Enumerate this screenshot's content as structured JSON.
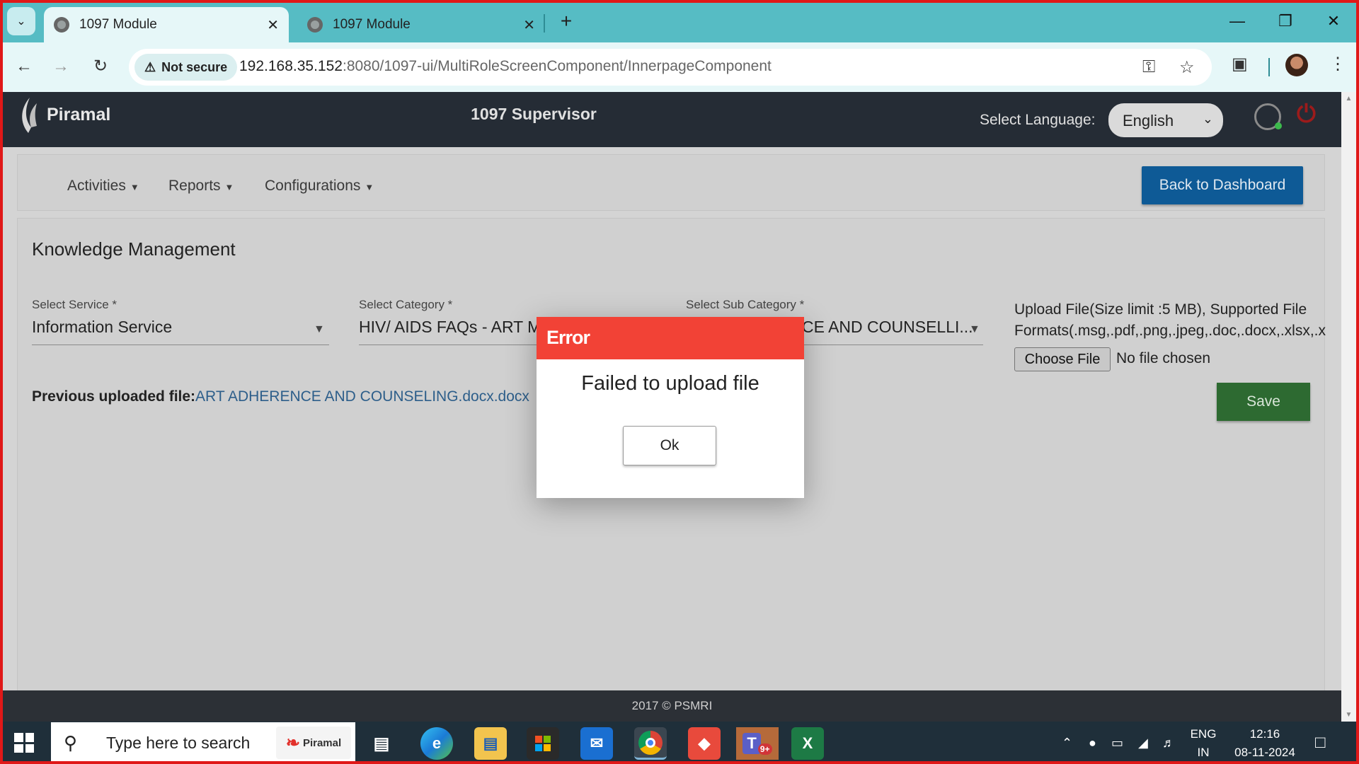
{
  "browser": {
    "tabs": [
      {
        "title": "1097 Module",
        "active": true
      },
      {
        "title": "1097 Module",
        "active": false
      }
    ],
    "security_label": "Not secure",
    "url_host": "192.168.35.152",
    "url_rest": ":8080/1097-ui/MultiRoleScreenComponent/InnerpageComponent"
  },
  "app": {
    "brand": "Piramal",
    "title": "1097 Supervisor",
    "language_label": "Select Language:",
    "language_value": "English"
  },
  "menu": {
    "items": [
      "Activities",
      "Reports",
      "Configurations"
    ],
    "back_button": "Back to Dashboard"
  },
  "form": {
    "title": "Knowledge Management",
    "service_label": "Select Service *",
    "service_value": "Information Service",
    "category_label": "Select Category *",
    "category_value": "HIV/ AIDS FAQs - ART Mar",
    "subcategory_label": "Select Sub Category *",
    "subcategory_value": "CE AND COUNSELLI...",
    "upload_text_line1": "Upload File(Size limit :5 MB), Supported File",
    "upload_text_line2": "Formats(.msg,.pdf,.png,.jpeg,.doc,.docx,.xlsx,.xls",
    "choose_file": "Choose File",
    "no_file": "No file chosen",
    "previous_label": "Previous uploaded file:",
    "previous_file": "ART ADHERENCE AND COUNSELING.docx.docx",
    "save": "Save"
  },
  "dialog": {
    "title": "Error",
    "message": "Failed to upload file",
    "ok": "Ok"
  },
  "footer": "2017 © PSMRI",
  "taskbar": {
    "search_placeholder": "Type here to search",
    "search_brand": "Piramal",
    "teams_badge": "9+",
    "lang_top": "ENG",
    "lang_bottom": "IN",
    "time": "12:16",
    "date": "08-11-2024"
  }
}
